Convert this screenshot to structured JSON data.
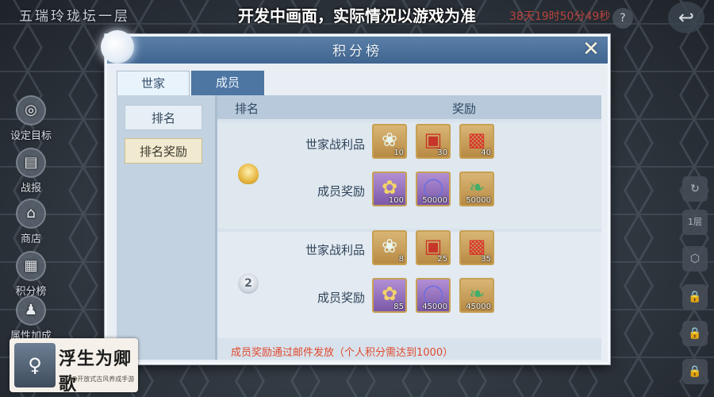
{
  "hud": {
    "location_title": "五瑞玲珑坛一层",
    "banner_text": "开发中画面，实际情况以游戏为准",
    "timer_text": "38天19时50分49秒",
    "help_icon": "?",
    "back_icon": "↩"
  },
  "side_menu": [
    {
      "label": "设定目标",
      "icon": "target-icon",
      "glyph": "◎"
    },
    {
      "label": "战报",
      "icon": "report-icon",
      "glyph": "▤"
    },
    {
      "label": "商店",
      "icon": "shop-icon",
      "glyph": "⌂"
    },
    {
      "label": "积分榜",
      "icon": "leaderboard-icon",
      "glyph": "▦"
    },
    {
      "label": "属性加成",
      "icon": "attribute-icon",
      "glyph": "♟"
    }
  ],
  "right_icons": [
    "↻",
    "1层",
    "⬡",
    "🔒",
    "🔒",
    "🔒"
  ],
  "modal": {
    "title": "积分榜",
    "close_label": "✕",
    "tabs": [
      {
        "label": "世家",
        "active": true
      },
      {
        "label": "成员",
        "active": false
      }
    ],
    "left_buttons": [
      {
        "label": "排名",
        "selected": false
      },
      {
        "label": "排名奖励",
        "selected": true
      }
    ],
    "table_headers": {
      "rank": "排名",
      "reward": "奖励"
    },
    "rows": [
      {
        "rank_glyph": "",
        "groups": [
          {
            "label": "世家战利品",
            "items": [
              {
                "name": "lotus",
                "glyph": "❀",
                "qty": "10",
                "frame": "gold"
              },
              {
                "name": "red-box",
                "glyph": "▣",
                "qty": "30",
                "frame": "gold"
              },
              {
                "name": "red-chest",
                "glyph": "▩",
                "qty": "40",
                "frame": "gold"
              }
            ]
          },
          {
            "label": "成员奖励",
            "items": [
              {
                "name": "golden-flower",
                "glyph": "✿",
                "qty": "100",
                "frame": "purple"
              },
              {
                "name": "jade-ring",
                "glyph": "◯",
                "qty": "50000",
                "frame": "purple"
              },
              {
                "name": "green-gourd",
                "glyph": "❧",
                "qty": "50000",
                "frame": "gold"
              }
            ]
          }
        ]
      },
      {
        "rank_glyph": "2",
        "groups": [
          {
            "label": "世家战利品",
            "items": [
              {
                "name": "lotus",
                "glyph": "❀",
                "qty": "8",
                "frame": "gold"
              },
              {
                "name": "red-box",
                "glyph": "▣",
                "qty": "25",
                "frame": "gold"
              },
              {
                "name": "red-chest",
                "glyph": "▩",
                "qty": "35",
                "frame": "gold"
              }
            ]
          },
          {
            "label": "成员奖励",
            "items": [
              {
                "name": "golden-flower",
                "glyph": "✿",
                "qty": "85",
                "frame": "purple"
              },
              {
                "name": "jade-ring",
                "glyph": "◯",
                "qty": "45000",
                "frame": "purple"
              },
              {
                "name": "green-gourd",
                "glyph": "❧",
                "qty": "45000",
                "frame": "gold"
              }
            ]
          }
        ]
      }
    ],
    "footer_note": "成员奖励通过邮件发放（个人积分需达到1000）"
  },
  "logo": {
    "name": "浮生为卿歌",
    "tagline": "—3D开放式古风养成手游—"
  },
  "colors": {
    "header_blue": "#4a729c",
    "note_red": "#e0492e",
    "gold_frame": "#c6a054",
    "purple_frame": "#8a66b6"
  }
}
